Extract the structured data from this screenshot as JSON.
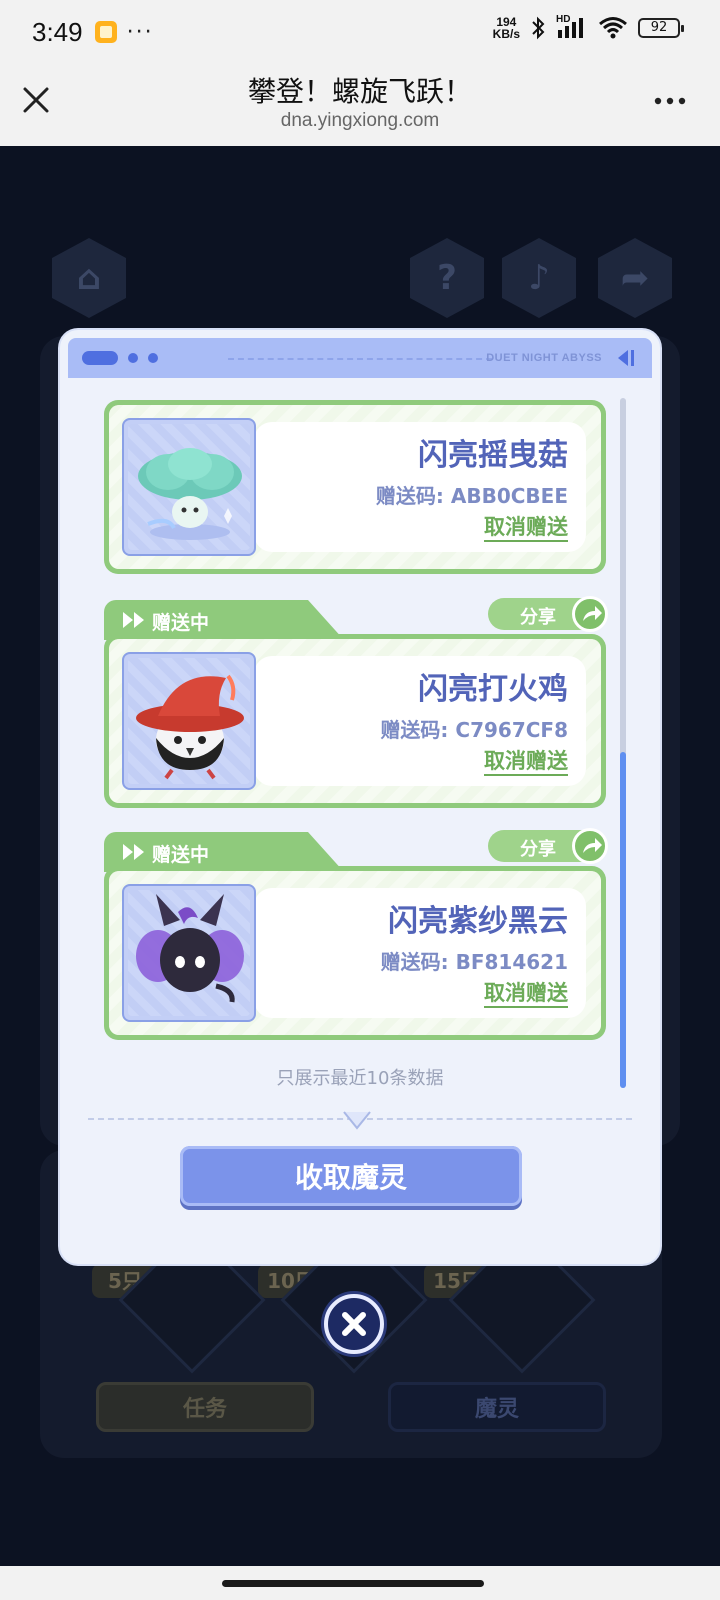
{
  "status_bar": {
    "time": "3:49",
    "more": "···",
    "net_speed_value": "194",
    "net_speed_unit": "KB/s",
    "signal_label": "HD",
    "battery": "92"
  },
  "browser": {
    "title": "攀登！螺旋飞跃！",
    "url": "dna.yingxiong.com"
  },
  "modal": {
    "brand": "DUET NIGHT ABYSS",
    "items": [
      {
        "status": "",
        "share": "",
        "name": "闪亮摇曳菇",
        "code": "赠送码: ABB0CBEE",
        "cancel": "取消赠送",
        "icon": "mushroom-spirit"
      },
      {
        "status": "赠送中",
        "share": "分享",
        "name": "闪亮打火鸡",
        "code": "赠送码: C7967CF8",
        "cancel": "取消赠送",
        "icon": "red-hat-bird-spirit"
      },
      {
        "status": "赠送中",
        "share": "分享",
        "name": "闪亮紫纱黑云",
        "code": "赠送码: BF814621",
        "cancel": "取消赠送",
        "icon": "purple-cloud-spirit"
      }
    ],
    "footnote": "只展示最近10条数据",
    "collect_button": "收取魔灵"
  },
  "background": {
    "counts": [
      "5只",
      "10只",
      "15只"
    ],
    "tabs": [
      "任务",
      "魔灵"
    ],
    "icons": [
      "home-icon",
      "help-icon",
      "music-icon",
      "share-icon"
    ]
  },
  "colors": {
    "card_green": "#8fca7c",
    "name_blue": "#5264b8",
    "button_blue": "#7b93ea"
  }
}
